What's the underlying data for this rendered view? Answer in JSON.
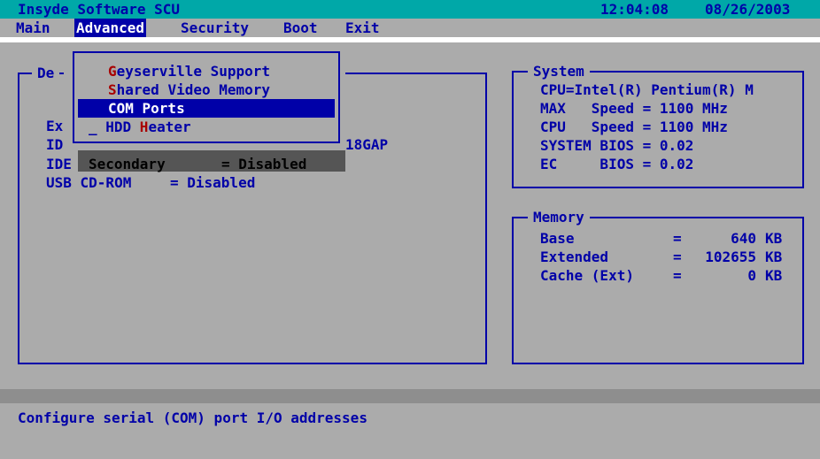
{
  "title_bar": {
    "app_title": "Insyde Software SCU",
    "time": "12:04:08",
    "date": "08/26/2003"
  },
  "menu": {
    "items": [
      {
        "label": "Main"
      },
      {
        "label": "Advanced"
      },
      {
        "label": "Security"
      },
      {
        "label": "Boot"
      },
      {
        "label": "Exit"
      }
    ]
  },
  "left_panel": {
    "title_fragment": "De",
    "partial_rows": [
      "Ex",
      "ID",
      "IDE"
    ],
    "partial_right": "18GAP",
    "rows": [
      {
        "label": "Secondary",
        "value": "= Disabled"
      },
      {
        "label": "USB CD-ROM",
        "value": "= Disabled"
      }
    ]
  },
  "dropdown": {
    "items": [
      {
        "hotkey": "G",
        "rest": "eyserville Support"
      },
      {
        "hotkey": "S",
        "rest": "hared Video Memory"
      },
      {
        "label": "COM Ports"
      },
      {
        "prefix": "_ HDD ",
        "hotkey": "H",
        "rest": "eater"
      }
    ]
  },
  "system_panel": {
    "title": "System",
    "lines": [
      "CPU=Intel(R) Pentium(R) M",
      "MAX   Speed = 1100 MHz",
      "CPU   Speed = 1100 MHz",
      "SYSTEM BIOS = 0.02",
      "EC     BIOS = 0.02"
    ]
  },
  "memory_panel": {
    "title": "Memory",
    "rows": [
      {
        "label": "Base",
        "eq": "=",
        "value": "640",
        "unit": "KB"
      },
      {
        "label": "Extended",
        "eq": "=",
        "value": "102655",
        "unit": "KB"
      },
      {
        "label": "Cache (Ext)",
        "eq": "=",
        "value": "0",
        "unit": "KB"
      }
    ]
  },
  "status_bar": {
    "text": "Configure serial (COM) port I/O addresses"
  }
}
